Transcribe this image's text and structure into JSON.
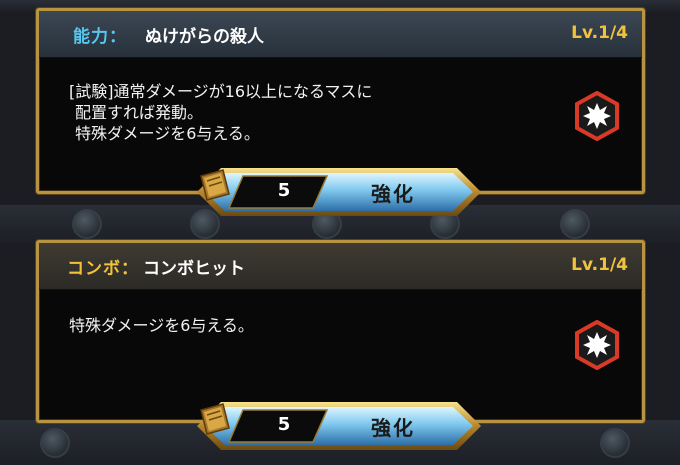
{
  "ability_card": {
    "label": "能力：",
    "name": "ぬけがらの殺人",
    "level": "Lv.1/4",
    "description_lines": [
      "[試験]通常ダメージが16以上になるマスに",
      "配置すれば発動。",
      "特殊ダメージを6与える。"
    ],
    "icon": "explosion-icon",
    "upgrade": {
      "cost": "5",
      "label": "強化"
    }
  },
  "combo_card": {
    "label": "コンボ：",
    "name": "コンボヒット",
    "level": "Lv.1/4",
    "description_lines": [
      "特殊ダメージを6与える。"
    ],
    "icon": "explosion-icon",
    "upgrade": {
      "cost": "5",
      "label": "強化"
    }
  },
  "colors": {
    "border_gold": "#b89341",
    "ability_label": "#58c6ee",
    "combo_label": "#f2c23d",
    "level_text": "#f2c23d",
    "badge_red": "#d93a28",
    "button_blue": "#7fc8ee"
  }
}
